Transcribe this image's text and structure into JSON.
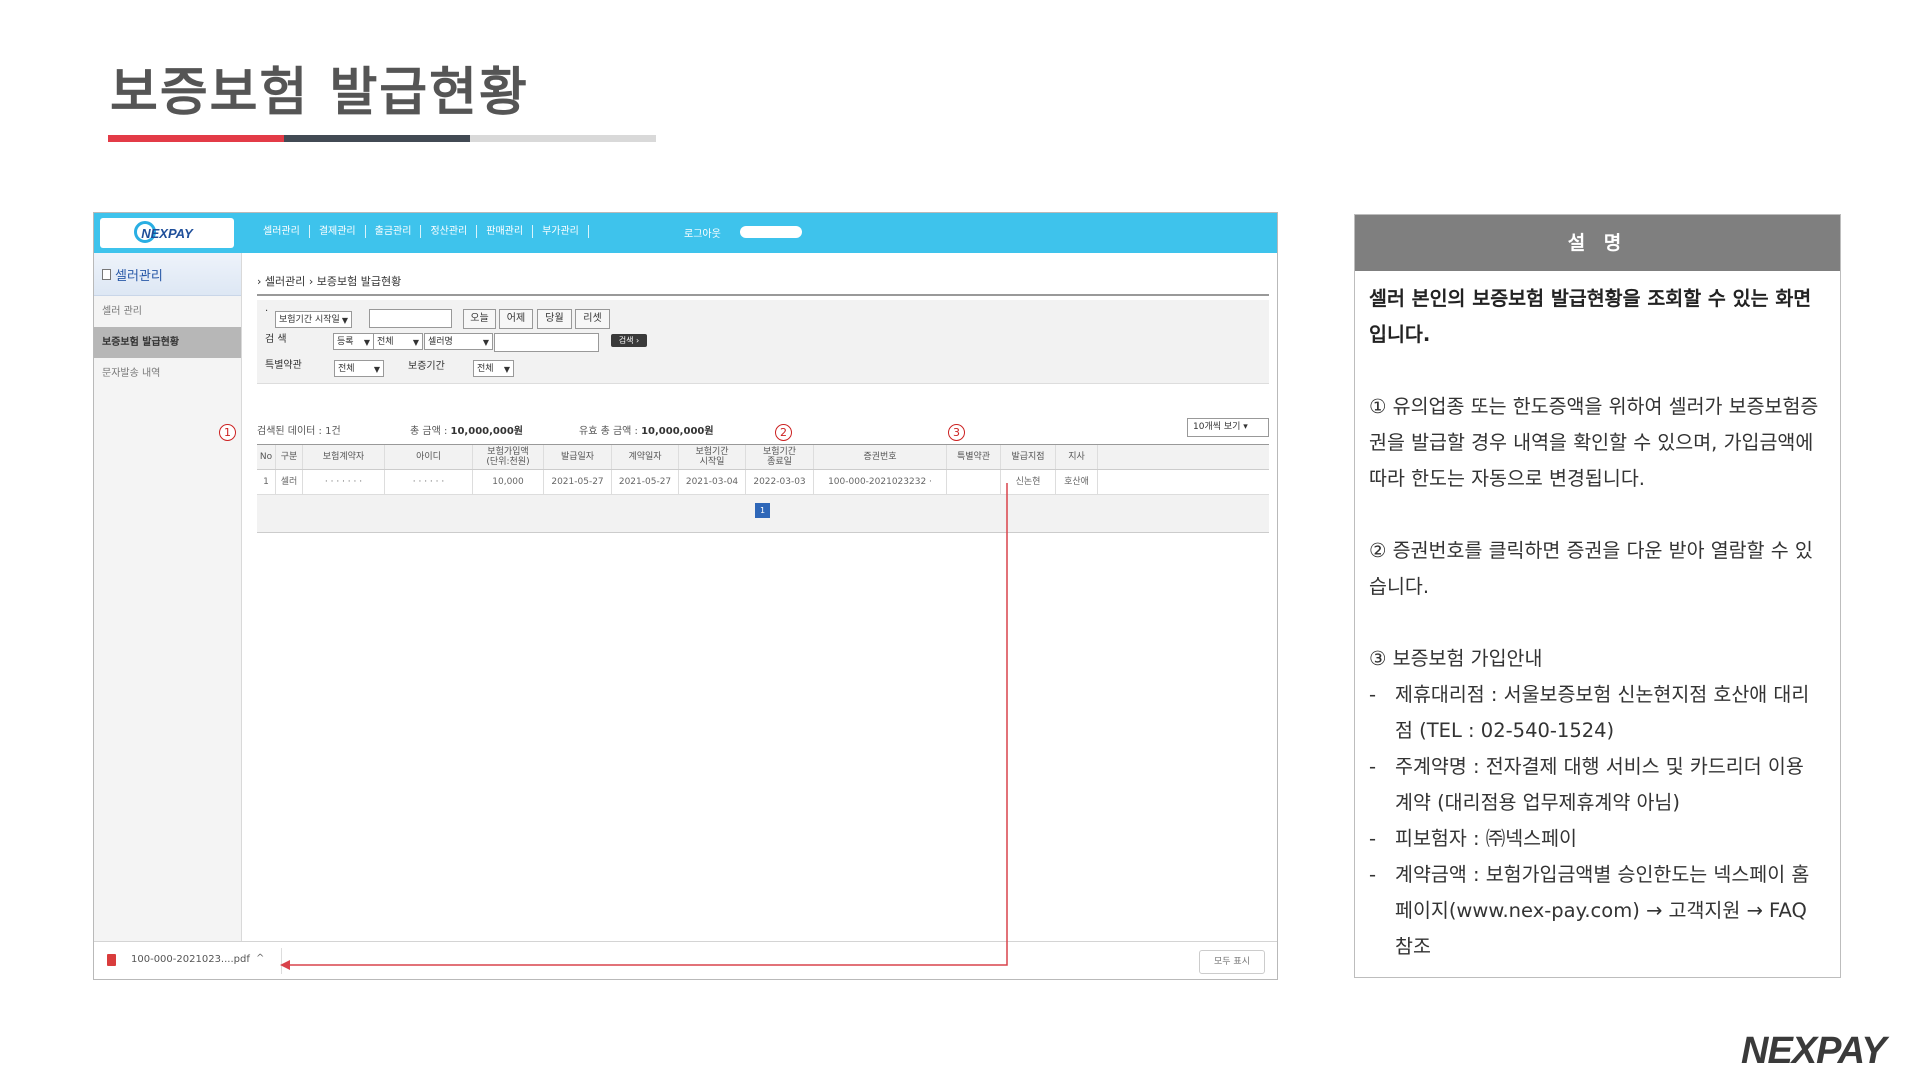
{
  "slide": {
    "title": "보증보험 발급현황",
    "underline_colors": [
      "#e33b47",
      "#424a54",
      "#d9d9d9"
    ],
    "brand": "NEXPAY"
  },
  "app": {
    "accent": "#3ec3ec",
    "logo_text": "NEXPAY",
    "top_menu": [
      "셀러관리",
      "결제관리",
      "출금관리",
      "정산관리",
      "판매관리",
      "부가관리"
    ],
    "logout": "로그아웃",
    "sidebar": {
      "header": "셀러관리",
      "items": [
        {
          "label": "셀러 관리",
          "active": false
        },
        {
          "label": "보증보험 발급현황",
          "active": true
        },
        {
          "label": "문자발송 내역",
          "active": false
        }
      ]
    },
    "breadcrumb": "› 셀러관리 › 보증보험 발급현황",
    "search": {
      "date_type": "보험기간 시작일",
      "date_value": "",
      "date_buttons": [
        "오늘",
        "어제",
        "당월",
        "리셋"
      ],
      "search_label": "검   색",
      "sel_status": "등록",
      "sel_all": "전체",
      "sel_field": "셀러명",
      "keyword": "",
      "search_button": "검색 ›",
      "special_label": "특별약관",
      "special_value": "전체",
      "period_label": "보증기간",
      "period_value": "전체"
    },
    "stats": {
      "found": "검색된 데이터 : 1건",
      "total_label": "총 금액 : ",
      "total_value": "10,000,000원",
      "valid_label": "유효 총 금액 : ",
      "valid_value": "10,000,000원"
    },
    "page_size": "10개씩 보기",
    "table": {
      "headers": [
        "No",
        "구분",
        "보험계약자",
        "아이디",
        "보험가입액\n(단위:천원)",
        "발급일자",
        "계약일자",
        "보험기간\n시작일",
        "보험기간\n종료일",
        "증권번호",
        "특별약관",
        "발급지점",
        "지사"
      ],
      "rows": [
        [
          "1",
          "셀러",
          "· · · · · · ·",
          "· · · · · ·",
          "10,000",
          "2021-05-27",
          "2021-05-27",
          "2021-03-04",
          "2022-03-03",
          "100-000-2021023232 ·",
          "",
          "신논현",
          "호산애"
        ]
      ]
    },
    "pager": {
      "current": "1"
    },
    "markers": [
      "1",
      "2",
      "3"
    ],
    "download": {
      "file": "100-000-2021023....pdf",
      "show_all": "모두 표시"
    },
    "connector_color": "#d9434b"
  },
  "description": {
    "header": "설 명",
    "intro": "셀러 본인의 보증보험 발급현황을 조회할 수 있는 화면입니다.",
    "p1": "① 유의업종 또는 한도증액을 위하여 셀러가 보증보험증권을 발급할 경우 내역을 확인할 수 있으며, 가입금액에 따라 한도는 자동으로 변경됩니다.",
    "p2": "② 증권번호를 클릭하면 증권을 다운 받아 열람할 수 있습니다.",
    "p3_title": "③ 보증보험 가입안내",
    "bullets": [
      "제휴대리점 : 서울보증보험 신논현지점 호산애 대리점 (TEL : 02-540-1524)",
      "주계약명 : 전자결제 대행 서비스 및 카드리더 이용 계약 (대리점용 업무제휴계약 아님)",
      "피보험자 : ㈜넥스페이",
      "계약금액 : 보험가입금액별 승인한도는 넥스페이 홈페이지(www.nex-pay.com) → 고객지원 → FAQ 참조"
    ]
  }
}
